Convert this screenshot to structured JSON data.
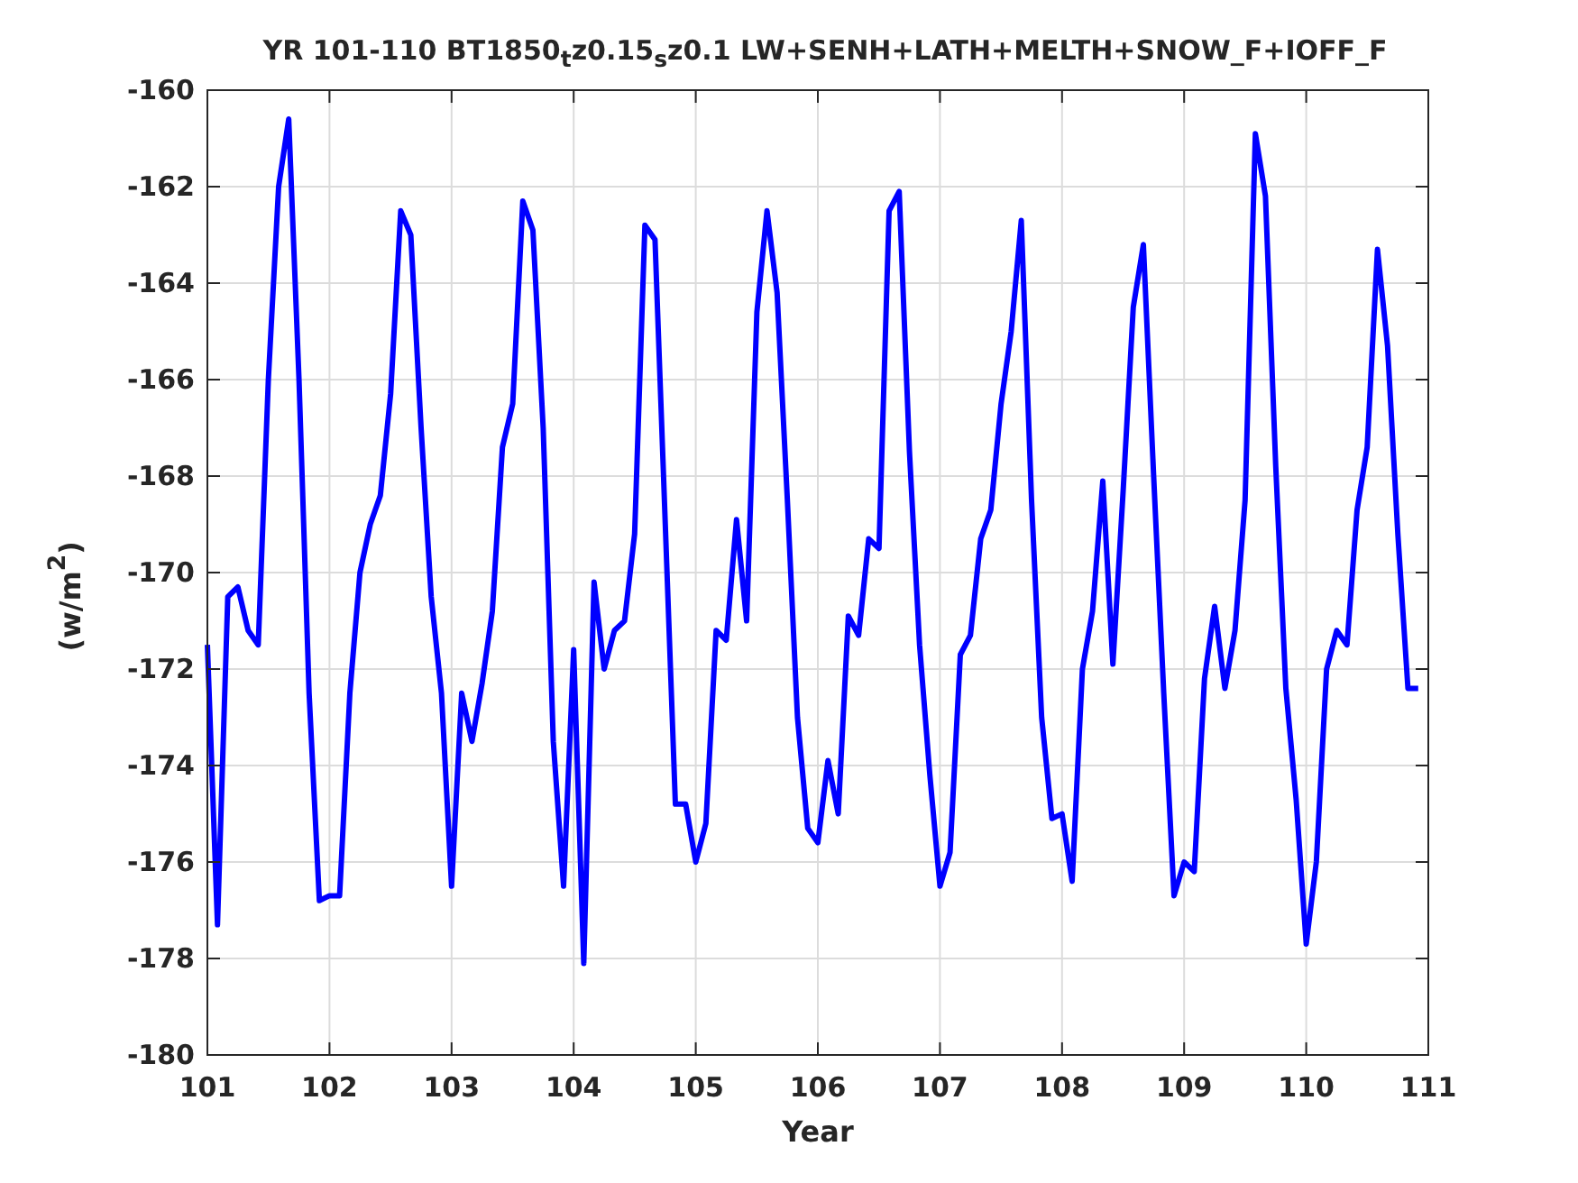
{
  "figure": {
    "title": "YR 101-110 BT1850$_{t}$z0.15$_{s}$z0.1 LW+SENH+LATH+MELTH+SNOW_F+IOFF_F",
    "chart_data": {
      "type": "line",
      "xlabel": "Year",
      "ylabel": "(w/m$^{2}$)",
      "xlim": [
        101,
        111
      ],
      "ylim": [
        -180,
        -160
      ],
      "xticks": [
        101,
        102,
        103,
        104,
        105,
        106,
        107,
        108,
        109,
        110,
        111
      ],
      "yticks": [
        -180,
        -178,
        -176,
        -174,
        -172,
        -170,
        -168,
        -166,
        -164,
        -162,
        -160
      ],
      "series": [
        {
          "color": "#0000ff",
          "values": [
            -171.5,
            -177.3,
            -170.5,
            -170.3,
            -171.2,
            -171.5,
            -166,
            -162,
            -160.6,
            -166,
            -172.5,
            -176.8,
            -176.7,
            -176.7,
            -172.5,
            -170,
            -169,
            -168.4,
            -166.3,
            -162.5,
            -163,
            -167,
            -170.5,
            -172.5,
            -176.5,
            -172.5,
            -173.5,
            -172.3,
            -170.8,
            -167.4,
            -166.5,
            -162.3,
            -162.9,
            -167,
            -173.5,
            -176.5,
            -171.6,
            -178.1,
            -170.2,
            -172,
            -171.2,
            -171,
            -169.2,
            -162.8,
            -163.1,
            -169,
            -174.8,
            -174.8,
            -176,
            -175.2,
            -171.2,
            -171.4,
            -168.9,
            -171,
            -164.6,
            -162.5,
            -164.2,
            -168.5,
            -173,
            -175.3,
            -175.6,
            -173.9,
            -175,
            -170.9,
            -171.3,
            -169.3,
            -169.5,
            -162.5,
            -162.1,
            -167.5,
            -171.5,
            -174.2,
            -176.5,
            -175.8,
            -171.7,
            -171.3,
            -169.3,
            -168.7,
            -166.5,
            -165,
            -162.7,
            -168.5,
            -173,
            -175.1,
            -175,
            -176.4,
            -172,
            -170.8,
            -168.1,
            -171.9,
            -168.3,
            -164.5,
            -163.2,
            -168,
            -172.5,
            -176.7,
            -176,
            -176.2,
            -172.2,
            -170.7,
            -172.4,
            -171.2,
            -168.5,
            -160.9,
            -162.2,
            -167.8,
            -172.4,
            -174.7,
            -177.7,
            -176,
            -172,
            -171.2,
            -171.5,
            -168.7,
            -167.4,
            -163.3,
            -165.3,
            -169.2,
            -172.4,
            -172.4
          ]
        }
      ],
      "grid": true,
      "x": [
        101,
        101.0833,
        101.1667,
        101.25,
        101.3333,
        101.4167,
        101.5,
        101.5833,
        101.6667,
        101.75,
        101.8333,
        101.9167,
        102,
        102.0833,
        102.1667,
        102.25,
        102.3333,
        102.4167,
        102.5,
        102.5833,
        102.6667,
        102.75,
        102.8333,
        102.9167,
        103,
        103.0833,
        103.1667,
        103.25,
        103.3333,
        103.4167,
        103.5,
        103.5833,
        103.6667,
        103.75,
        103.8333,
        103.9167,
        104,
        104.0833,
        104.1667,
        104.25,
        104.3333,
        104.4167,
        104.5,
        104.5833,
        104.6667,
        104.75,
        104.8333,
        104.9167,
        105,
        105.0833,
        105.1667,
        105.25,
        105.3333,
        105.4167,
        105.5,
        105.5833,
        105.6667,
        105.75,
        105.8333,
        105.9167,
        106,
        106.0833,
        106.1667,
        106.25,
        106.3333,
        106.4167,
        106.5,
        106.5833,
        106.6667,
        106.75,
        106.8333,
        106.9167,
        107,
        107.0833,
        107.1667,
        107.25,
        107.3333,
        107.4167,
        107.5,
        107.5833,
        107.6667,
        107.75,
        107.8333,
        107.9167,
        108,
        108.0833,
        108.1667,
        108.25,
        108.3333,
        108.4167,
        108.5,
        108.5833,
        108.6667,
        108.75,
        108.8333,
        108.9167,
        109,
        109.0833,
        109.1667,
        109.25,
        109.3333,
        109.4167,
        109.5,
        109.5833,
        109.6667,
        109.75,
        109.8333,
        109.9167,
        110,
        110.0833,
        110.1667,
        110.25,
        110.3333,
        110.4167,
        110.5,
        110.5833,
        110.6667,
        110.75,
        110.8333,
        110.9167
      ]
    }
  }
}
